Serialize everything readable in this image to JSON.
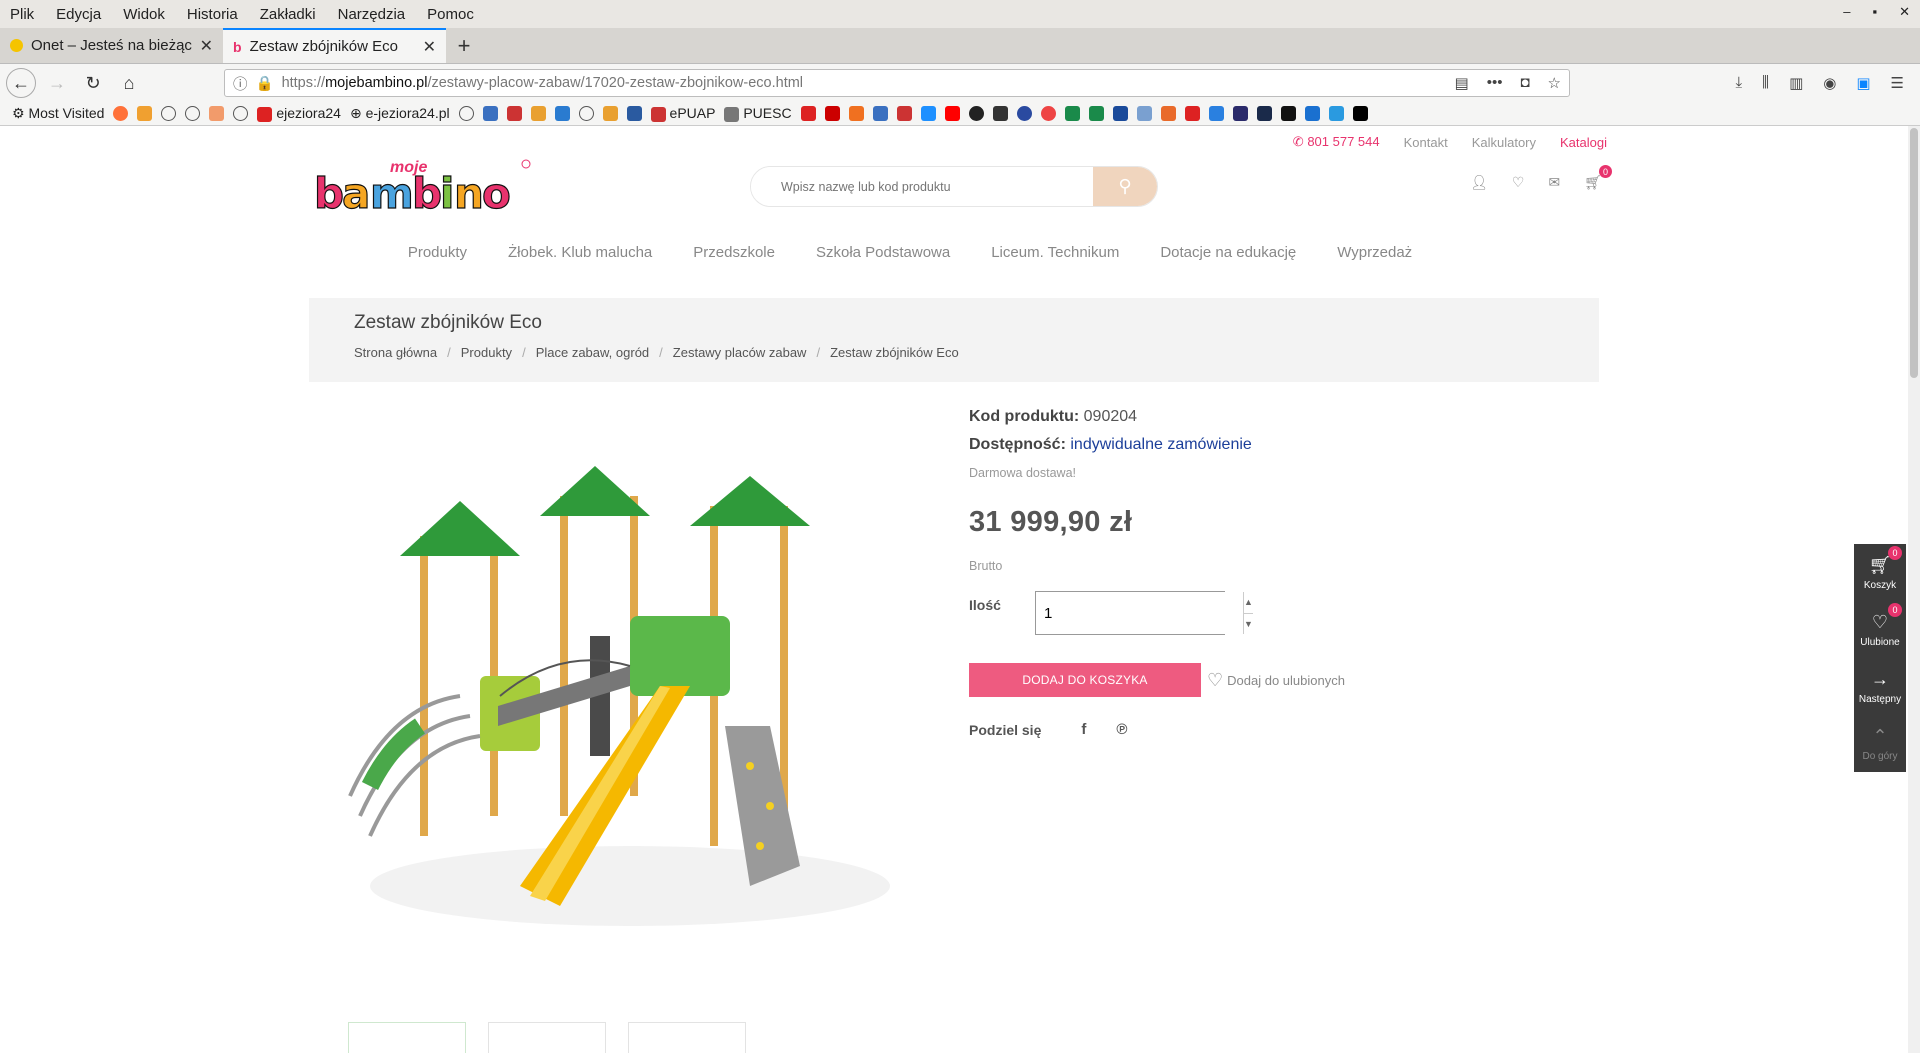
{
  "browser": {
    "menu": [
      "Plik",
      "Edycja",
      "Widok",
      "Historia",
      "Zakładki",
      "Narzędzia",
      "Pomoc"
    ],
    "tabs": [
      {
        "title": "Onet – Jesteś na bieżąco"
      },
      {
        "title": "Zestaw zbójników Eco"
      }
    ],
    "url": {
      "proto": "https://",
      "host": "mojebambino.pl",
      "path": "/zestawy-placow-zabaw/17020-zestaw-zbojnikow-eco.html"
    },
    "bookmarks": {
      "most_visited": "Most Visited",
      "ejeziora24": "ejeziora24",
      "ejeziora24pl": "e-jeziora24.pl",
      "epuap": "ePUAP",
      "puesc": "PUESC"
    }
  },
  "site": {
    "phone": "801 577 544",
    "links": {
      "kontakt": "Kontakt",
      "kalkulatory": "Kalkulatory",
      "katalogi": "Katalogi"
    },
    "search_placeholder": "Wpisz nazwę lub kod produktu",
    "cart_count": "0",
    "nav": [
      "Produkty",
      "Żłobek. Klub malucha",
      "Przedszkole",
      "Szkoła Podstawowa",
      "Liceum. Technikum",
      "Dotacje na edukację",
      "Wyprzedaż"
    ]
  },
  "page": {
    "title": "Zestaw zbójników Eco",
    "breadcrumbs": [
      "Strona główna",
      "Produkty",
      "Place zabaw, ogród",
      "Zestawy placów zabaw",
      "Zestaw zbójników Eco"
    ]
  },
  "product": {
    "code_label": "Kod produktu:",
    "code": "090204",
    "avail_label": "Dostępność:",
    "avail": "indywidualne zamówienie",
    "free_shipping": "Darmowa dostawa!",
    "price": "31 999,90 zł",
    "brutto": "Brutto",
    "qty_label": "Ilość",
    "qty": "1",
    "add_to_cart": "DODAJ DO KOSZYKA",
    "add_fav": "Dodaj do ulubionych",
    "share_label": "Podziel się"
  },
  "side_panel": {
    "koszyk": "Koszyk",
    "koszyk_count": "0",
    "ulubione": "Ulubione",
    "ulubione_count": "0",
    "nastepny": "Następny",
    "do_gory": "Do góry"
  },
  "colors": {
    "accent": "#ee5b80",
    "pink_link": "#e8336d",
    "avail_blue": "#1c3f9a"
  }
}
